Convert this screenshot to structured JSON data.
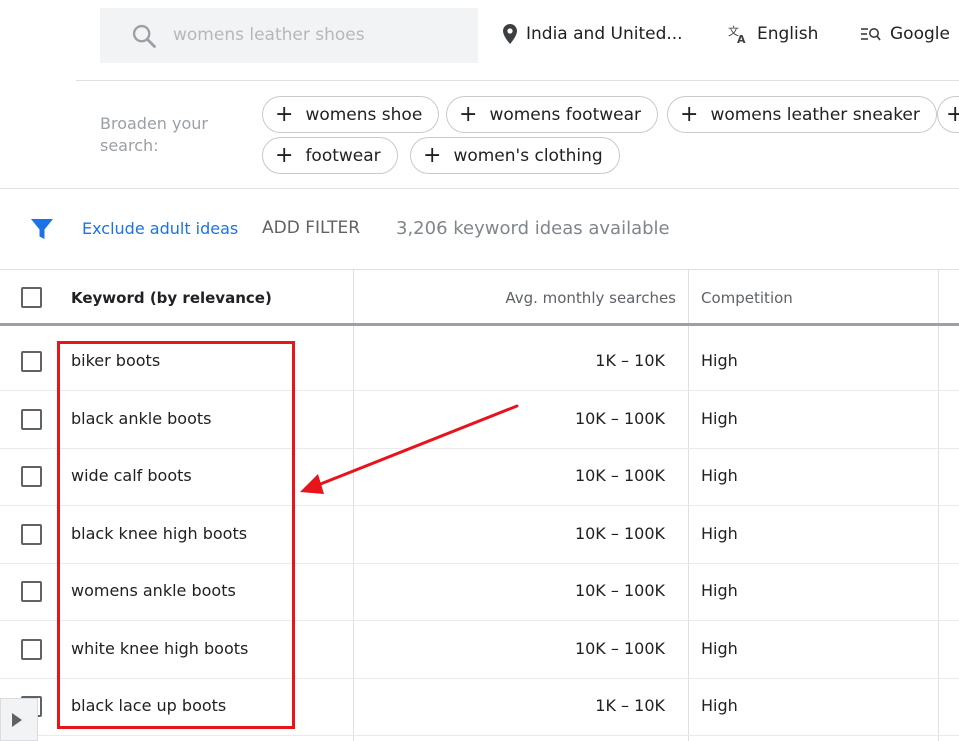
{
  "search": {
    "value": "womens leather shoes"
  },
  "location": {
    "label": "India and United..."
  },
  "language": {
    "label": "English"
  },
  "network": {
    "label": "Google"
  },
  "broaden": {
    "label": "Broaden your search:",
    "chips": [
      "womens shoe",
      "womens footwear",
      "womens leather sneaker",
      "footwear",
      "women's clothing"
    ]
  },
  "filters": {
    "exclude_label": "Exclude adult ideas",
    "add_label": "ADD FILTER",
    "count_text": "3,206 keyword ideas available"
  },
  "table": {
    "headers": {
      "keyword": "Keyword (by relevance)",
      "avg": "Avg. monthly searches",
      "competition": "Competition"
    },
    "rows": [
      {
        "keyword": "biker boots",
        "avg": "1K – 10K",
        "competition": "High"
      },
      {
        "keyword": "black ankle boots",
        "avg": "10K – 100K",
        "competition": "High"
      },
      {
        "keyword": "wide calf boots",
        "avg": "10K – 100K",
        "competition": "High"
      },
      {
        "keyword": "black knee high boots",
        "avg": "10K – 100K",
        "competition": "High"
      },
      {
        "keyword": "womens ankle boots",
        "avg": "10K – 100K",
        "competition": "High"
      },
      {
        "keyword": "white knee high boots",
        "avg": "10K – 100K",
        "competition": "High"
      },
      {
        "keyword": "black lace up boots",
        "avg": "1K – 10K",
        "competition": "High"
      }
    ]
  },
  "colors": {
    "accent": "#1a73e8",
    "annotation": "#e8141c"
  }
}
